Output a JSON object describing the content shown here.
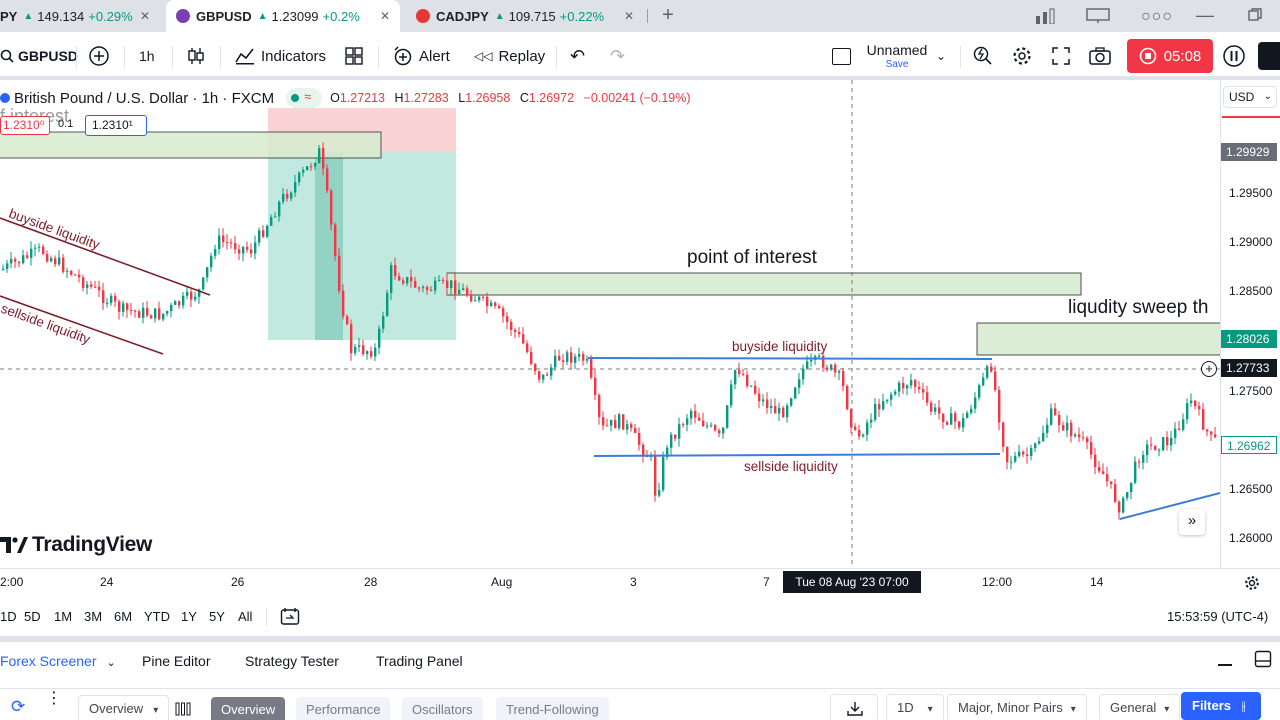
{
  "browser_tabs": [
    {
      "symbol": "PY",
      "price": "149.134",
      "change": "+0.29%",
      "active": false
    },
    {
      "symbol": "GBPUSD",
      "price": "1.23099",
      "change": "+0.2%",
      "active": true
    },
    {
      "symbol": "CADJPY",
      "price": "109.715",
      "change": "+0.22%",
      "active": false
    }
  ],
  "toolbar": {
    "symbol": "GBPUSD",
    "interval": "1h",
    "indicators": "Indicators",
    "alert": "Alert",
    "replay": "Replay",
    "layout_name": "Unnamed",
    "layout_save": "Save",
    "record_time": "05:08"
  },
  "legend": {
    "title": "British Pound / U.S. Dollar · 1h · FXCM",
    "o_label": "O",
    "o": "1.27213",
    "h_label": "H",
    "h": "1.27283",
    "l_label": "L",
    "l": "1.26958",
    "c_label": "C",
    "c": "1.26972",
    "change": "−0.00241 (−0.19%)",
    "pos_left": "1.2310⁰",
    "pos_mid": "0.1",
    "pos_right": "1.2310¹",
    "stray_text": "f interest"
  },
  "annotations": {
    "buyside_left": "buyside liquidity",
    "sellside_left": "sellside liquidity",
    "point_of_interest": "point of interest",
    "liquidity_sweep": "liqudity sweep th",
    "buyside_range": "buyside liquidity",
    "sellside_range": "sellside liquidity"
  },
  "logo": "TradingView",
  "price_axis": {
    "currency": "USD",
    "ticks": [
      "1.29500",
      "1.29000",
      "1.28500",
      "1.27500",
      "1.26500",
      "1.26000"
    ],
    "tag_top": "1.29929",
    "tag_green": "1.28026",
    "tag_cross": "1.27733",
    "tag_last": "1.26962"
  },
  "time_axis": {
    "ticks": [
      "2:00",
      "24",
      "26",
      "28",
      "Aug",
      "3",
      "7",
      "12:00",
      "14"
    ],
    "crosshair": "Tue 08 Aug '23   07:00"
  },
  "range_bar": {
    "ranges": [
      "1D",
      "5D",
      "1M",
      "3M",
      "6M",
      "YTD",
      "1Y",
      "5Y",
      "All"
    ],
    "clock": "15:53:59 (UTC-4)"
  },
  "bottom_tabs": [
    "Forex Screener",
    "Pine Editor",
    "Strategy Tester",
    "Trading Panel"
  ],
  "screener": {
    "overview_select": "Overview",
    "tabs": [
      "Overview",
      "Performance",
      "Oscillators",
      "Trend-Following"
    ],
    "timeframe": "1D",
    "pairs": "Major, Minor Pairs",
    "general": "General",
    "filters": "Filters"
  },
  "colors": {
    "up": "#089981",
    "down": "#f23645",
    "accent": "#2962ff",
    "zone_green": "#d8ecd0",
    "trend_red": "#7b1e2a",
    "range_blue": "#3d7dd8"
  }
}
